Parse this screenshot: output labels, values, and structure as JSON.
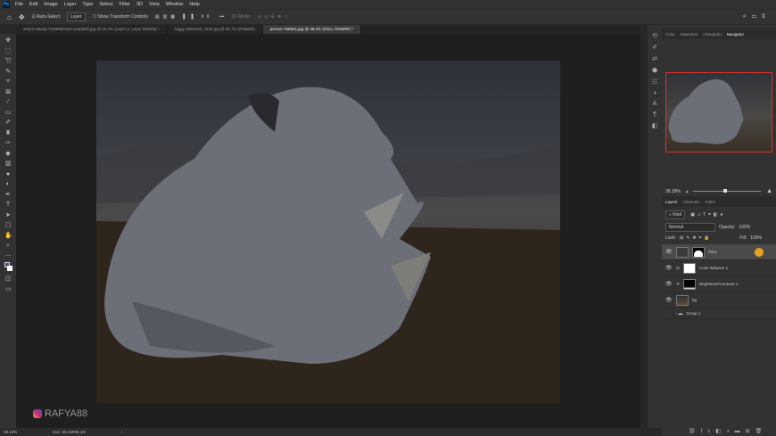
{
  "menu": {
    "logo": "Ps",
    "items": [
      "File",
      "Edit",
      "Image",
      "Layer",
      "Type",
      "Select",
      "Filter",
      "3D",
      "View",
      "Window",
      "Help"
    ]
  },
  "options": {
    "auto_select": "Auto-Select",
    "layer_select": "Layer",
    "show_transform": "Show Transform Controls",
    "mode_3d": "3D Mode:"
  },
  "tabs": [
    {
      "label": "ashes-sitoula-Tn0986Dsw4-unsplash.jpg @ 25.4% (Layer 0, Layer Mask/8) *",
      "active": false
    },
    {
      "label": "foggy-4564618_1920.jpg @ 66.7% (RGB/8#)",
      "active": false
    },
    {
      "label": "person-768591.jpg @ 38.2% (rhino, RGB/8#) *",
      "active": true
    }
  ],
  "watermark": "RAFYA88",
  "status": {
    "zoom": "38.18%",
    "doc": "Doc: 55.1M/95.1M"
  },
  "top_panel": {
    "tabs": [
      "Color",
      "Swatches",
      "Histogram",
      "Navigator"
    ],
    "active": "Navigator",
    "zoom": "38.18%"
  },
  "layers_panel": {
    "tabs": [
      "Layers",
      "Channels",
      "Paths"
    ],
    "active": "Layers",
    "filter": "Kind",
    "blend_mode": "Normal",
    "opacity_label": "Opacity:",
    "opacity": "100%",
    "lock_label": "Lock:",
    "fill_label": "Fill:",
    "fill": "100%",
    "layers": [
      {
        "name": "rhino",
        "selected": true,
        "visible": true
      },
      {
        "name": "Color Balance 1",
        "selected": false,
        "visible": true
      },
      {
        "name": "Brightness/Contrast 1",
        "selected": false,
        "visible": true
      },
      {
        "name": "bg",
        "selected": false,
        "visible": true
      },
      {
        "name": "Group 1",
        "selected": false,
        "visible": false
      }
    ]
  },
  "colors": {
    "accent": "#e8a020",
    "nav_frame": "#e03030"
  }
}
